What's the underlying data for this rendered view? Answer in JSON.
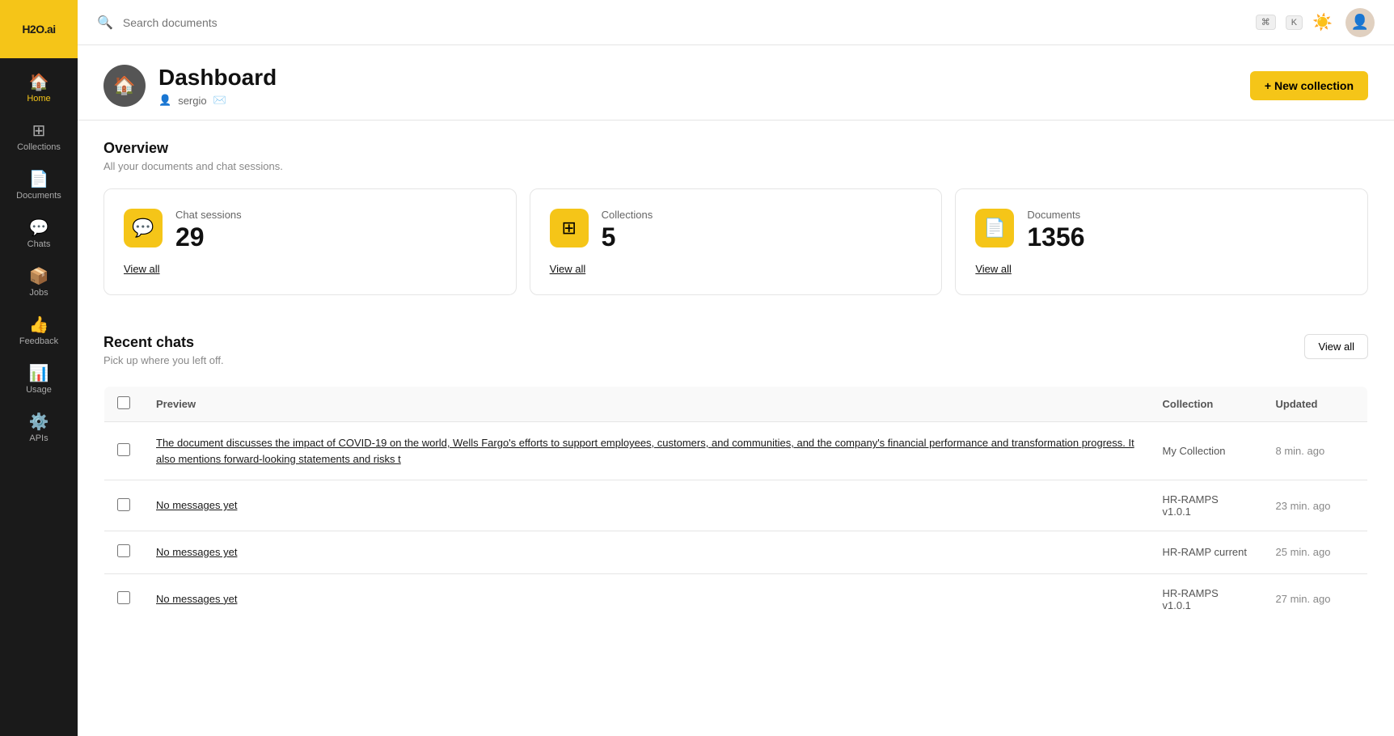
{
  "app": {
    "logo_text": "H2O.ai"
  },
  "sidebar": {
    "items": [
      {
        "id": "home",
        "label": "Home",
        "icon": "🏠",
        "active": true
      },
      {
        "id": "collections",
        "label": "Collections",
        "icon": "⊞",
        "active": false
      },
      {
        "id": "documents",
        "label": "Documents",
        "icon": "📄",
        "active": false
      },
      {
        "id": "chats",
        "label": "Chats",
        "icon": "💬",
        "active": false
      },
      {
        "id": "jobs",
        "label": "Jobs",
        "icon": "📦",
        "active": false
      },
      {
        "id": "feedback",
        "label": "Feedback",
        "icon": "👍",
        "active": false
      },
      {
        "id": "usage",
        "label": "Usage",
        "icon": "📊",
        "active": false
      },
      {
        "id": "apis",
        "label": "APIs",
        "icon": "⚙️",
        "active": false
      }
    ]
  },
  "topbar": {
    "search_placeholder": "Search documents",
    "kbd1": "⌘",
    "kbd2": "K"
  },
  "page_header": {
    "title": "Dashboard",
    "username": "sergio",
    "new_collection_label": "+ New collection"
  },
  "overview": {
    "title": "Overview",
    "subtitle": "All your documents and chat sessions.",
    "stats": [
      {
        "id": "chat-sessions",
        "label": "Chat sessions",
        "value": "29",
        "view_all_text": "View all",
        "icon": "💬"
      },
      {
        "id": "collections",
        "label": "Collections",
        "value": "5",
        "view_all_text": "View all",
        "icon": "⊞"
      },
      {
        "id": "documents",
        "label": "Documents",
        "value": "1356",
        "view_all_text": "View all",
        "icon": "📄"
      }
    ]
  },
  "recent_chats": {
    "title": "Recent chats",
    "subtitle": "Pick up where you left off.",
    "view_all_label": "View all",
    "table_headers": {
      "preview": "Preview",
      "collection": "Collection",
      "updated": "Updated"
    },
    "rows": [
      {
        "id": "row-1",
        "preview": "The document discusses the impact of COVID-19 on the world, Wells Fargo's efforts to support employees, customers, and communities, and the company's financial performance and transformation progress. It also mentions forward-looking statements and risks t",
        "collection": "My Collection",
        "updated": "8 min. ago"
      },
      {
        "id": "row-2",
        "preview": "No messages yet",
        "collection": "HR-RAMPS v1.0.1",
        "updated": "23 min. ago"
      },
      {
        "id": "row-3",
        "preview": "No messages yet",
        "collection": "HR-RAMP current",
        "updated": "25 min. ago"
      },
      {
        "id": "row-4",
        "preview": "No messages yet",
        "collection": "HR-RAMPS v1.0.1",
        "updated": "27 min. ago"
      }
    ]
  }
}
